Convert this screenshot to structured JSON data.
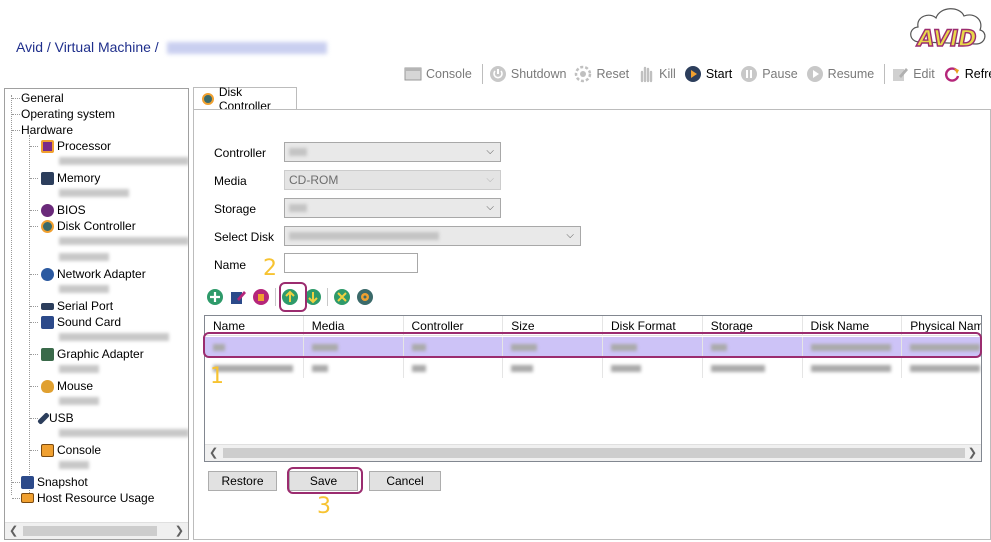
{
  "breadcrumb": {
    "root": "Avid",
    "sep1": " / ",
    "section": "Virtual Machine",
    "sep2": " / "
  },
  "logo": {
    "text": "AVID",
    "color": "#e8d84a",
    "outline": "#9b2c6f"
  },
  "toolbar": {
    "console": "Console",
    "shutdown": "Shutdown",
    "reset": "Reset",
    "kill": "Kill",
    "start": "Start",
    "pause": "Pause",
    "resume": "Resume",
    "edit": "Edit",
    "refresh": "Refresh"
  },
  "tree": {
    "general": "General",
    "os": "Operating system",
    "hardware": "Hardware",
    "processor": "Processor",
    "memory": "Memory",
    "bios": "BIOS",
    "disk_controller": "Disk Controller",
    "network_adapter": "Network Adapter",
    "serial_port": "Serial Port",
    "sound_card": "Sound Card",
    "graphic_adapter": "Graphic Adapter",
    "mouse": "Mouse",
    "usb": "USB",
    "console": "Console",
    "snapshot": "Snapshot",
    "host_resource": "Host Resource Usage"
  },
  "tab": {
    "label": "Disk Controller"
  },
  "form": {
    "controller_label": "Controller",
    "media_label": "Media",
    "media_value": "CD-ROM",
    "storage_label": "Storage",
    "select_disk_label": "Select Disk",
    "name_label": "Name"
  },
  "grid": {
    "columns": [
      "Name",
      "Media",
      "Controller",
      "Size",
      "Disk Format",
      "Storage",
      "Disk Name",
      "Physical Name"
    ]
  },
  "buttons": {
    "restore": "Restore",
    "save": "Save",
    "cancel": "Cancel"
  },
  "annotations": {
    "step1": "1",
    "step2": "2",
    "step3": "3"
  },
  "colors": {
    "accent": "#9b2c6f",
    "selected_row": "#cdc3f7",
    "annotation": "#f7c331",
    "link": "#1f2f8c"
  }
}
